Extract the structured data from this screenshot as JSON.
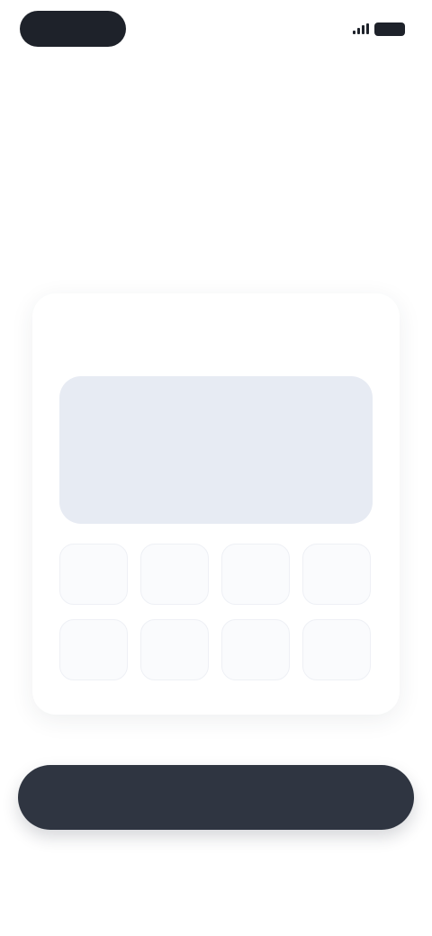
{
  "status_bar": {
    "time": "",
    "signal_icon": "signal-bars-icon",
    "battery_icon": "battery-icon"
  },
  "header": {
    "title": "",
    "subtitle": ""
  },
  "card": {
    "label": "",
    "display_text": "",
    "keys": [
      "",
      "",
      "",
      "",
      "",
      "",
      "",
      ""
    ]
  },
  "actions": {
    "primary_label": "",
    "secondary_label": ""
  },
  "colors": {
    "primary_button": "#2f3541",
    "display_background": "#e7ebf3",
    "status_pill": "#1e222a"
  }
}
